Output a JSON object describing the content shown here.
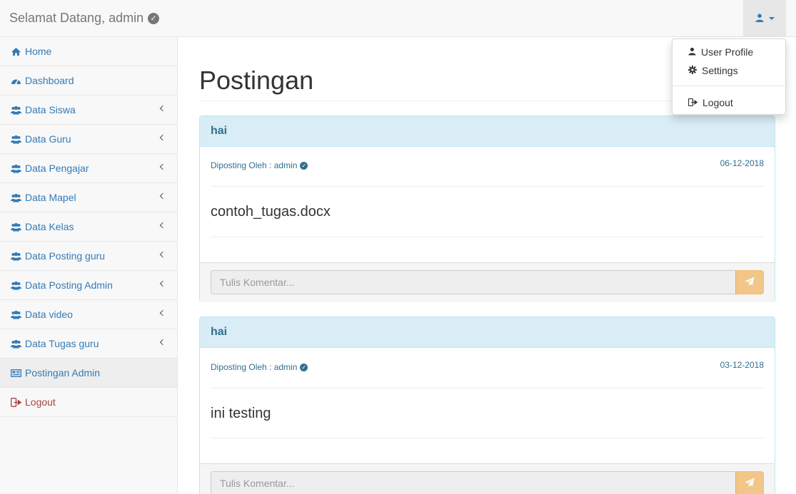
{
  "navbar": {
    "brand": "Selamat Datang, admin",
    "user_menu": {
      "items": [
        {
          "label": "User Profile",
          "icon": "user-icon"
        },
        {
          "label": "Settings",
          "icon": "gear-icon"
        },
        {
          "label": "Logout",
          "icon": "sign-out-icon"
        }
      ]
    }
  },
  "sidebar": {
    "items": [
      {
        "label": "Home",
        "icon": "home-icon"
      },
      {
        "label": "Dashboard",
        "icon": "dashboard-icon"
      },
      {
        "label": "Data Siswa",
        "icon": "users-icon"
      },
      {
        "label": "Data Guru",
        "icon": "users-icon"
      },
      {
        "label": "Data Pengajar",
        "icon": "users-icon"
      },
      {
        "label": "Data Mapel",
        "icon": "users-icon"
      },
      {
        "label": "Data Kelas",
        "icon": "users-icon"
      },
      {
        "label": "Data Posting guru",
        "icon": "users-icon"
      },
      {
        "label": "Data Posting Admin",
        "icon": "users-icon"
      },
      {
        "label": "Data video",
        "icon": "users-icon"
      },
      {
        "label": "Data Tugas guru",
        "icon": "users-icon"
      },
      {
        "label": "Postingan Admin",
        "icon": "newspaper-icon"
      },
      {
        "label": "Logout",
        "icon": "sign-out-icon"
      }
    ]
  },
  "main": {
    "title": "Postingan",
    "posts": [
      {
        "title": "hai",
        "meta": "Diposting Oleh : admin",
        "date": "06-12-2018",
        "body": "contoh_tugas.docx",
        "comment_placeholder": "Tulis Komentar..."
      },
      {
        "title": "hai",
        "meta": "Diposting Oleh : admin",
        "date": "03-12-2018",
        "body": "ini testing",
        "comment_placeholder": "Tulis Komentar..."
      }
    ]
  },
  "colors": {
    "link": "#337ab7",
    "panel_heading": "#d9edf7",
    "panel_text": "#31708f",
    "warning": "#f0ad4e",
    "danger": "#a94442"
  }
}
